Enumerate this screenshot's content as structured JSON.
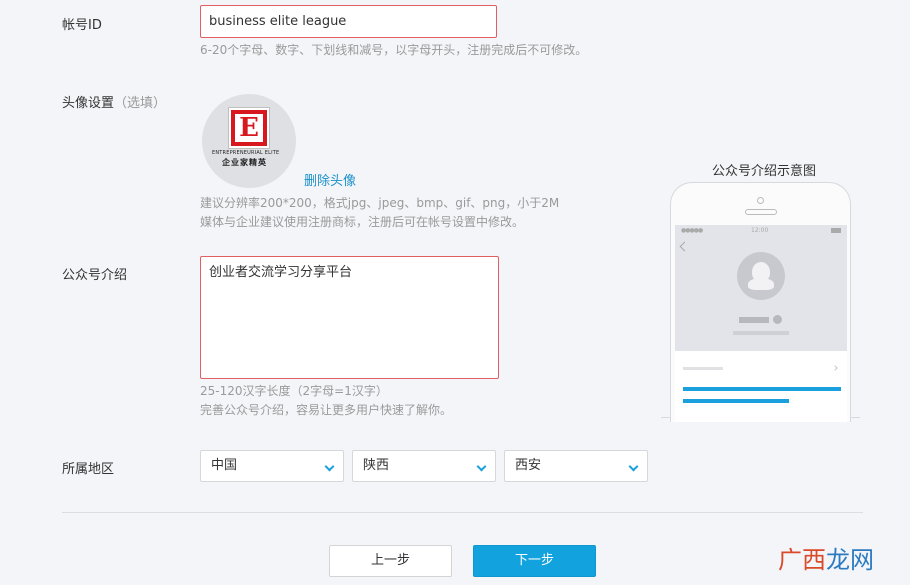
{
  "account_id": {
    "label": "帐号ID",
    "value": "business elite league",
    "hint": "6-20个字母、数字、下划线和减号，以字母开头，注册完成后不可修改。"
  },
  "avatar": {
    "label": "头像设置",
    "optional": "（选填）",
    "logo_letter": "E",
    "logo_line1": "ENTREPRENEURIAL ELITE",
    "logo_line2": "企业家精英",
    "delete_label": "删除头像",
    "hint_line1": "建议分辨率200*200，格式jpg、jpeg、bmp、gif、png，小于2M",
    "hint_line2": "媒体与企业建议使用注册商标，注册后可在帐号设置中修改。"
  },
  "intro": {
    "label": "公众号介绍",
    "value": "创业者交流学习分享平台",
    "hint_line1": "25-120汉字长度（2字母=1汉字）",
    "hint_line2": "完善公众号介绍，容易让更多用户快速了解你。"
  },
  "region": {
    "label": "所属地区",
    "country": "中国",
    "province": "陕西",
    "city": "西安"
  },
  "buttons": {
    "prev": "上一步",
    "next": "下一步"
  },
  "preview": {
    "title": "公众号介绍示意图",
    "status_dots": "●●●●●",
    "status_time": "12:00"
  },
  "watermark": {
    "part1": "广西",
    "part2": "龙网"
  },
  "colors": {
    "accent": "#12a2dd",
    "error_border": "#e15f63",
    "link": "#1a90c8"
  }
}
